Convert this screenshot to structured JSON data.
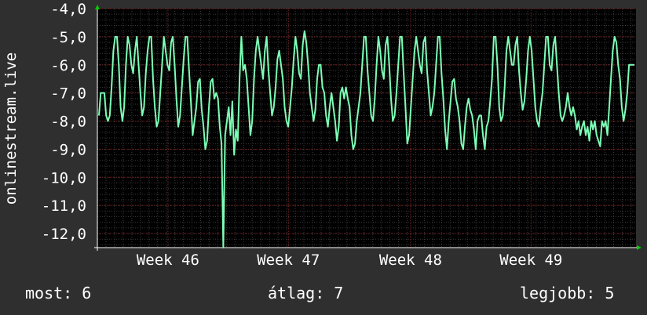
{
  "chart_data": {
    "type": "line",
    "ylabel": "onlinestream.live",
    "ylim": [
      -12.5,
      -4.0
    ],
    "y_ticks": [
      -4.0,
      -5.0,
      -6.0,
      -7.0,
      -8.0,
      -9.0,
      -10.0,
      -11.0,
      -12.0
    ],
    "y_tick_labels": [
      "-4,0",
      "-5,0",
      "-6,0",
      "-7,0",
      "-8,0",
      "-9,0",
      "-10,0",
      "-11,0",
      "-12,0"
    ],
    "x_range_days": [
      0,
      31.3
    ],
    "x_ticks": [
      {
        "label": "Week 46",
        "day": 4.1
      },
      {
        "label": "Week 47",
        "day": 11.1
      },
      {
        "label": "Week 48",
        "day": 18.2
      },
      {
        "label": "Week 49",
        "day": 25.2
      }
    ],
    "grid": true,
    "series": [
      {
        "color": "#7dffb7",
        "values": [
          -7.8,
          -7.0,
          -7.0,
          -7.0,
          -7.8,
          -8.0,
          -7.8,
          -6.8,
          -5.5,
          -5.0,
          -5.0,
          -6.0,
          -7.5,
          -8.0,
          -7.5,
          -6.0,
          -5.0,
          -5.3,
          -6.0,
          -6.3,
          -5.5,
          -5.0,
          -6.0,
          -7.0,
          -7.8,
          -7.5,
          -6.3,
          -5.5,
          -5.0,
          -5.0,
          -6.5,
          -7.5,
          -8.2,
          -8.0,
          -7.0,
          -6.0,
          -5.0,
          -5.5,
          -6.0,
          -6.2,
          -5.2,
          -5.0,
          -6.0,
          -7.2,
          -8.2,
          -7.8,
          -6.8,
          -5.8,
          -5.0,
          -5.0,
          -6.2,
          -7.3,
          -8.5,
          -8.0,
          -7.5,
          -6.6,
          -6.5,
          -7.6,
          -8.2,
          -9.0,
          -8.7,
          -7.5,
          -6.6,
          -6.5,
          -7.2,
          -7.0,
          -7.2,
          -8.2,
          -8.8,
          -12.5,
          -8.5,
          -8.0,
          -7.5,
          -8.5,
          -7.3,
          -9.2,
          -8.3,
          -8.7,
          -6.5,
          -5.0,
          -6.2,
          -6.0,
          -6.5,
          -7.5,
          -8.5,
          -8.0,
          -6.5,
          -5.5,
          -5.0,
          -5.5,
          -6.0,
          -6.5,
          -5.5,
          -5.0,
          -6.2,
          -7.0,
          -7.8,
          -7.5,
          -6.8,
          -5.8,
          -5.5,
          -6.0,
          -6.5,
          -7.5,
          -8.0,
          -8.2,
          -7.5,
          -6.8,
          -5.8,
          -5.0,
          -5.5,
          -6.3,
          -6.5,
          -5.3,
          -4.8,
          -5.2,
          -6.0,
          -7.0,
          -7.5,
          -8.0,
          -7.6,
          -6.5,
          -6.0,
          -6.0,
          -6.8,
          -7.0,
          -7.8,
          -8.2,
          -7.5,
          -7.0,
          -7.5,
          -8.0,
          -8.7,
          -8.2,
          -7.0,
          -6.8,
          -7.2,
          -6.8,
          -7.2,
          -7.5,
          -8.5,
          -9.0,
          -8.8,
          -8.0,
          -7.5,
          -7.0,
          -6.0,
          -5.0,
          -5.0,
          -6.2,
          -7.0,
          -7.8,
          -8.0,
          -7.2,
          -6.0,
          -5.0,
          -5.5,
          -6.2,
          -6.5,
          -5.3,
          -5.0,
          -6.0,
          -7.2,
          -8.0,
          -7.8,
          -7.0,
          -6.0,
          -5.0,
          -5.0,
          -6.3,
          -7.5,
          -8.8,
          -8.5,
          -7.5,
          -6.5,
          -5.5,
          -5.0,
          -5.5,
          -6.0,
          -6.3,
          -5.2,
          -5.0,
          -6.2,
          -7.0,
          -7.8,
          -7.5,
          -7.0,
          -6.0,
          -5.0,
          -5.0,
          -6.3,
          -7.2,
          -8.3,
          -9.0,
          -8.0,
          -7.3,
          -6.6,
          -6.5,
          -7.2,
          -7.5,
          -8.0,
          -8.8,
          -9.0,
          -8.2,
          -7.5,
          -7.2,
          -7.6,
          -7.8,
          -8.3,
          -9.0,
          -8.0,
          -7.8,
          -7.8,
          -8.5,
          -9.0,
          -8.2,
          -8.0,
          -7.3,
          -6.5,
          -5.0,
          -5.0,
          -6.0,
          -7.5,
          -8.0,
          -7.8,
          -6.8,
          -5.5,
          -5.0,
          -5.5,
          -6.0,
          -6.0,
          -5.3,
          -5.0,
          -6.2,
          -7.0,
          -7.6,
          -7.3,
          -6.5,
          -5.5,
          -5.0,
          -5.5,
          -6.5,
          -7.5,
          -8.0,
          -8.2,
          -7.5,
          -7.0,
          -6.0,
          -5.0,
          -5.0,
          -6.0,
          -6.2,
          -5.3,
          -5.0,
          -6.0,
          -7.0,
          -7.8,
          -8.0,
          -7.8,
          -7.5,
          -7.0,
          -7.5,
          -7.8,
          -7.5,
          -7.8,
          -8.3,
          -8.0,
          -8.5,
          -8.2,
          -8.0,
          -8.5,
          -8.2,
          -8.7,
          -8.0,
          -8.3,
          -8.0,
          -8.5,
          -8.7,
          -8.9,
          -8.0,
          -8.2,
          -8.0,
          -8.5,
          -7.5,
          -6.5,
          -5.5,
          -5.0,
          -5.2,
          -6.0,
          -6.5,
          -7.5,
          -8.0,
          -7.6,
          -7.0,
          -6.0,
          -6.0,
          -6.0,
          -6.0
        ]
      }
    ]
  },
  "stats": {
    "now": "most: 6",
    "avg": "átlag: 7",
    "max": "legjobb: 5"
  }
}
